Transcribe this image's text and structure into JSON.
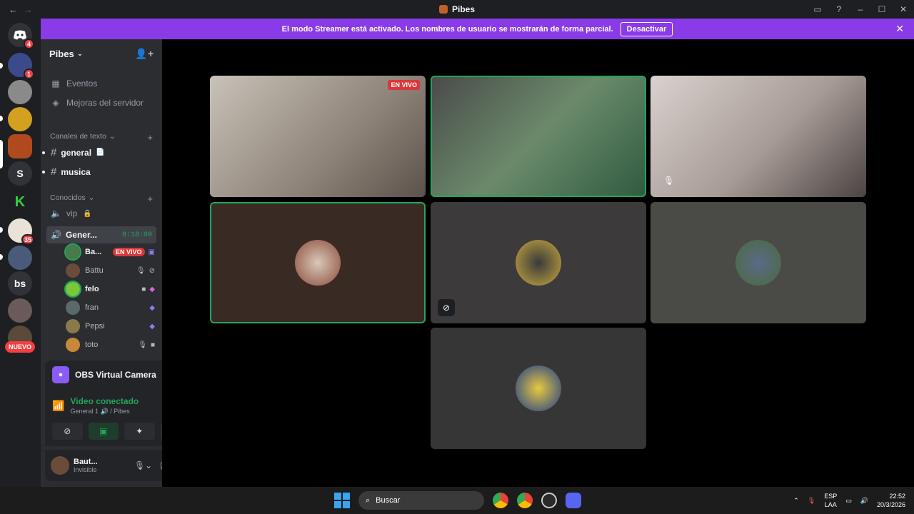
{
  "window": {
    "title": "Pibes",
    "back_icon": "←",
    "forward_icon": "→"
  },
  "banner": {
    "text": "El modo Streamer está activado. Los nombres de usuario se mostrarán de forma parcial.",
    "button": "Desactivar"
  },
  "servers": [
    {
      "label": "",
      "badge": "4",
      "kind": "discord-home"
    },
    {
      "label": "",
      "badge": "1"
    },
    {
      "label": "",
      "badge": ""
    },
    {
      "label": "",
      "badge": ""
    },
    {
      "label": "",
      "badge": ""
    },
    {
      "label": "S",
      "badge": ""
    },
    {
      "label": "",
      "badge": ""
    },
    {
      "label": "",
      "badge": "35"
    },
    {
      "label": "",
      "badge": ""
    },
    {
      "label": "bs",
      "badge": ""
    },
    {
      "label": "",
      "badge": ""
    },
    {
      "label": "",
      "badge": ""
    }
  ],
  "nuevo_label": "NUEVO",
  "sidebar": {
    "server_name": "Pibes",
    "events": "Eventos",
    "boosts": "Mejoras del servidor",
    "text_category": "Canales de texto",
    "text_channels": [
      {
        "name": "general"
      },
      {
        "name": "musica"
      }
    ],
    "voice_category": "Conocidos",
    "voice_channels": [
      {
        "name": "vip"
      }
    ],
    "active_voice": {
      "name": "Gener...",
      "timer": "8:18:09"
    },
    "voice_users": [
      {
        "name": "Ba...",
        "badge": "EN VIVO"
      },
      {
        "name": "Battu",
        "badge": ""
      },
      {
        "name": "felo",
        "badge": ""
      },
      {
        "name": "fran",
        "badge": ""
      },
      {
        "name": "Pepsi",
        "badge": ""
      },
      {
        "name": "toto",
        "badge": ""
      }
    ]
  },
  "obs": {
    "title": "OBS Virtual Camera"
  },
  "voice_connection": {
    "status": "Video conectado",
    "channel": "General 1 🔊 / Pibes"
  },
  "user": {
    "name": "Baut...",
    "status": "Invisible"
  },
  "tiles": [
    {
      "live": "EN VIVO"
    }
  ],
  "taskbar": {
    "search_placeholder": "Buscar",
    "lang_top": "ESP",
    "lang_bottom": "LAA",
    "time": "22:52",
    "date": "20/3/2026"
  }
}
